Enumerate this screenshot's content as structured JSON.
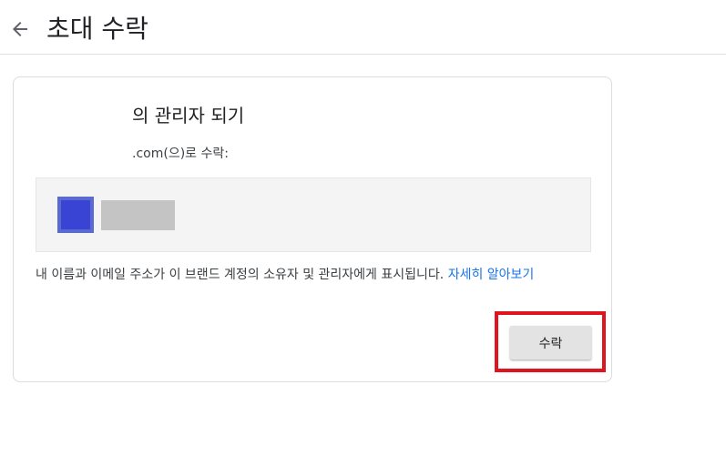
{
  "header": {
    "back_icon": "arrow-left-icon",
    "title": "초대 수락"
  },
  "card": {
    "heading": "의 관리자 되기",
    "subtitle": ".com(으)로 수락:",
    "notice_text": "내 이름과 이메일 주소가 이 브랜드 계정의 소유자 및 관리자에게 표시됩니다. ",
    "learn_more_link": "자세히 알아보기",
    "accept_label": "수락"
  },
  "colors": {
    "accent_link": "#1a73e8",
    "avatar": "#3a44d4",
    "highlight_border": "#e0141e",
    "button_bg": "#e3e3e3"
  }
}
